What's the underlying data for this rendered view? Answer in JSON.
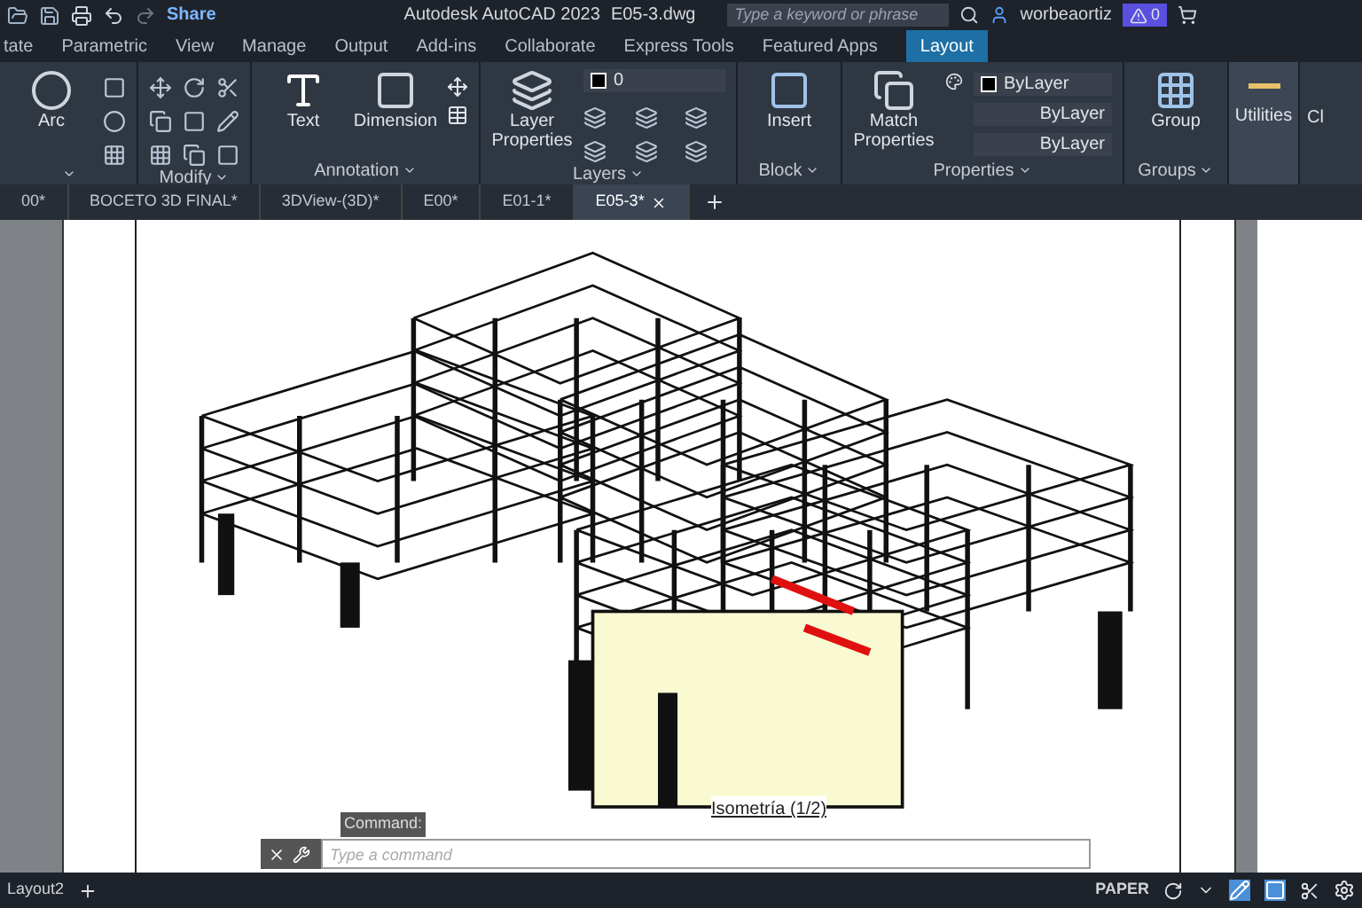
{
  "title_bar": {
    "share": "Share",
    "app_title": "Autodesk AutoCAD 2023",
    "file_name": "E05-3.dwg",
    "search": {
      "placeholder": "Type a keyword or phrase"
    },
    "user": "worbeaortiz",
    "alerts": "0"
  },
  "ribbon_tabs": [
    {
      "label": "tate",
      "selected": false
    },
    {
      "label": "Parametric",
      "selected": false
    },
    {
      "label": "View",
      "selected": false
    },
    {
      "label": "Manage",
      "selected": false
    },
    {
      "label": "Output",
      "selected": false
    },
    {
      "label": "Add-ins",
      "selected": false
    },
    {
      "label": "Collaborate",
      "selected": false
    },
    {
      "label": "Express Tools",
      "selected": false
    },
    {
      "label": "Featured Apps",
      "selected": false
    },
    {
      "label": "Layout",
      "selected": true
    }
  ],
  "ribbon": {
    "arc": "Arc",
    "modify": "Modify",
    "text": "Text",
    "dimension": "Dimension",
    "annotation": "Annotation",
    "layer_properties": "Layer Properties",
    "layer_value": "0",
    "layers": "Layers",
    "insert": "Insert",
    "block": "Block",
    "match_properties": "Match Properties",
    "color_layer": "ByLayer",
    "linetype": "ByLayer",
    "lineweight": "ByLayer",
    "properties": "Properties",
    "group": "Group",
    "groups": "Groups",
    "utilities": "Utilities",
    "column_8": "Cl"
  },
  "file_tabs": [
    {
      "label": "00*",
      "selected": false
    },
    {
      "label": "BOCETO 3D FINAL*",
      "selected": false
    },
    {
      "label": "3DView-(3D)*",
      "selected": false
    },
    {
      "label": "E00*",
      "selected": false
    },
    {
      "label": "E01-1*",
      "selected": false
    },
    {
      "label": "E05-3*",
      "selected": true
    }
  ],
  "viewport": {
    "label": "Isometría (1/2)"
  },
  "command_line": {
    "label": "Command:",
    "placeholder": "Type a command"
  },
  "status_bar": {
    "layout_tab": "Layout2",
    "space": "PAPER"
  }
}
